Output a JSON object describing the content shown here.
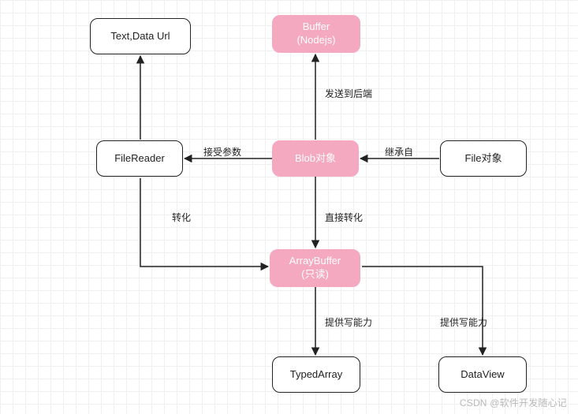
{
  "nodes": {
    "textDataUrl": {
      "line1": "Text,Data Url"
    },
    "buffer": {
      "line1": "Buffer",
      "line2": "(Nodejs)"
    },
    "fileReader": {
      "line1": "FileReader"
    },
    "blob": {
      "line1": "Blob对象"
    },
    "file": {
      "line1": "File对象"
    },
    "arrayBuffer": {
      "line1": "ArrayBuffer",
      "line2": "(只读)"
    },
    "typedArray": {
      "line1": "TypedArray"
    },
    "dataView": {
      "line1": "DataView"
    }
  },
  "edges": {
    "blobToBuffer": "发送到后端",
    "blobToFileReader": "接受参数",
    "fileToBlob": "继承自",
    "readerToArraybuf": "转化",
    "blobToArraybuf": "直接转化",
    "arraybufToTyped": "提供写能力",
    "arraybufToDataview": "提供写能力"
  },
  "watermark": "CSDN @软件开发随心记"
}
